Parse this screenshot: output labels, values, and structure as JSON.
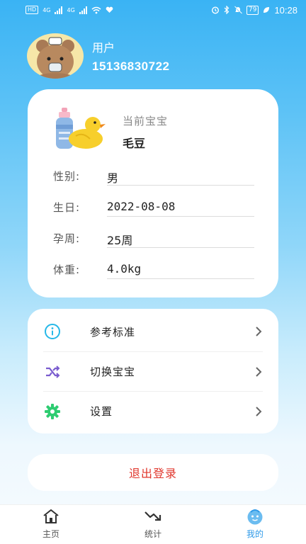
{
  "status_bar": {
    "left_chips": [
      "HD",
      "4G",
      "4G"
    ],
    "battery": "79",
    "time": "10:28"
  },
  "profile": {
    "username": "用户",
    "phone": "15136830722",
    "avatar_icon": "bear-avatar-icon"
  },
  "baby": {
    "current_label": "当前宝宝",
    "name": "毛豆",
    "fields": [
      {
        "label": "性别:",
        "value": "男"
      },
      {
        "label": "生日:",
        "value": "2022-08-08"
      },
      {
        "label": "孕周:",
        "value": "25周"
      },
      {
        "label": "体重:",
        "value": "4.0kg"
      }
    ]
  },
  "menu": {
    "items": [
      {
        "label": "参考标准",
        "icon": "info-icon",
        "color": "#26b8e8"
      },
      {
        "label": "切换宝宝",
        "icon": "shuffle-icon",
        "color": "#7a5ccf"
      },
      {
        "label": "设置",
        "icon": "gear-icon",
        "color": "#2ecc71"
      }
    ]
  },
  "logout_label": "退出登录",
  "tabbar": {
    "tabs": [
      {
        "label": "主页",
        "icon": "home-icon"
      },
      {
        "label": "统计",
        "icon": "trend-icon"
      },
      {
        "label": "我的",
        "icon": "baby-face-icon",
        "active": true
      }
    ]
  },
  "colors": {
    "accent": "#2f9ae8",
    "logout": "#e0362c"
  }
}
